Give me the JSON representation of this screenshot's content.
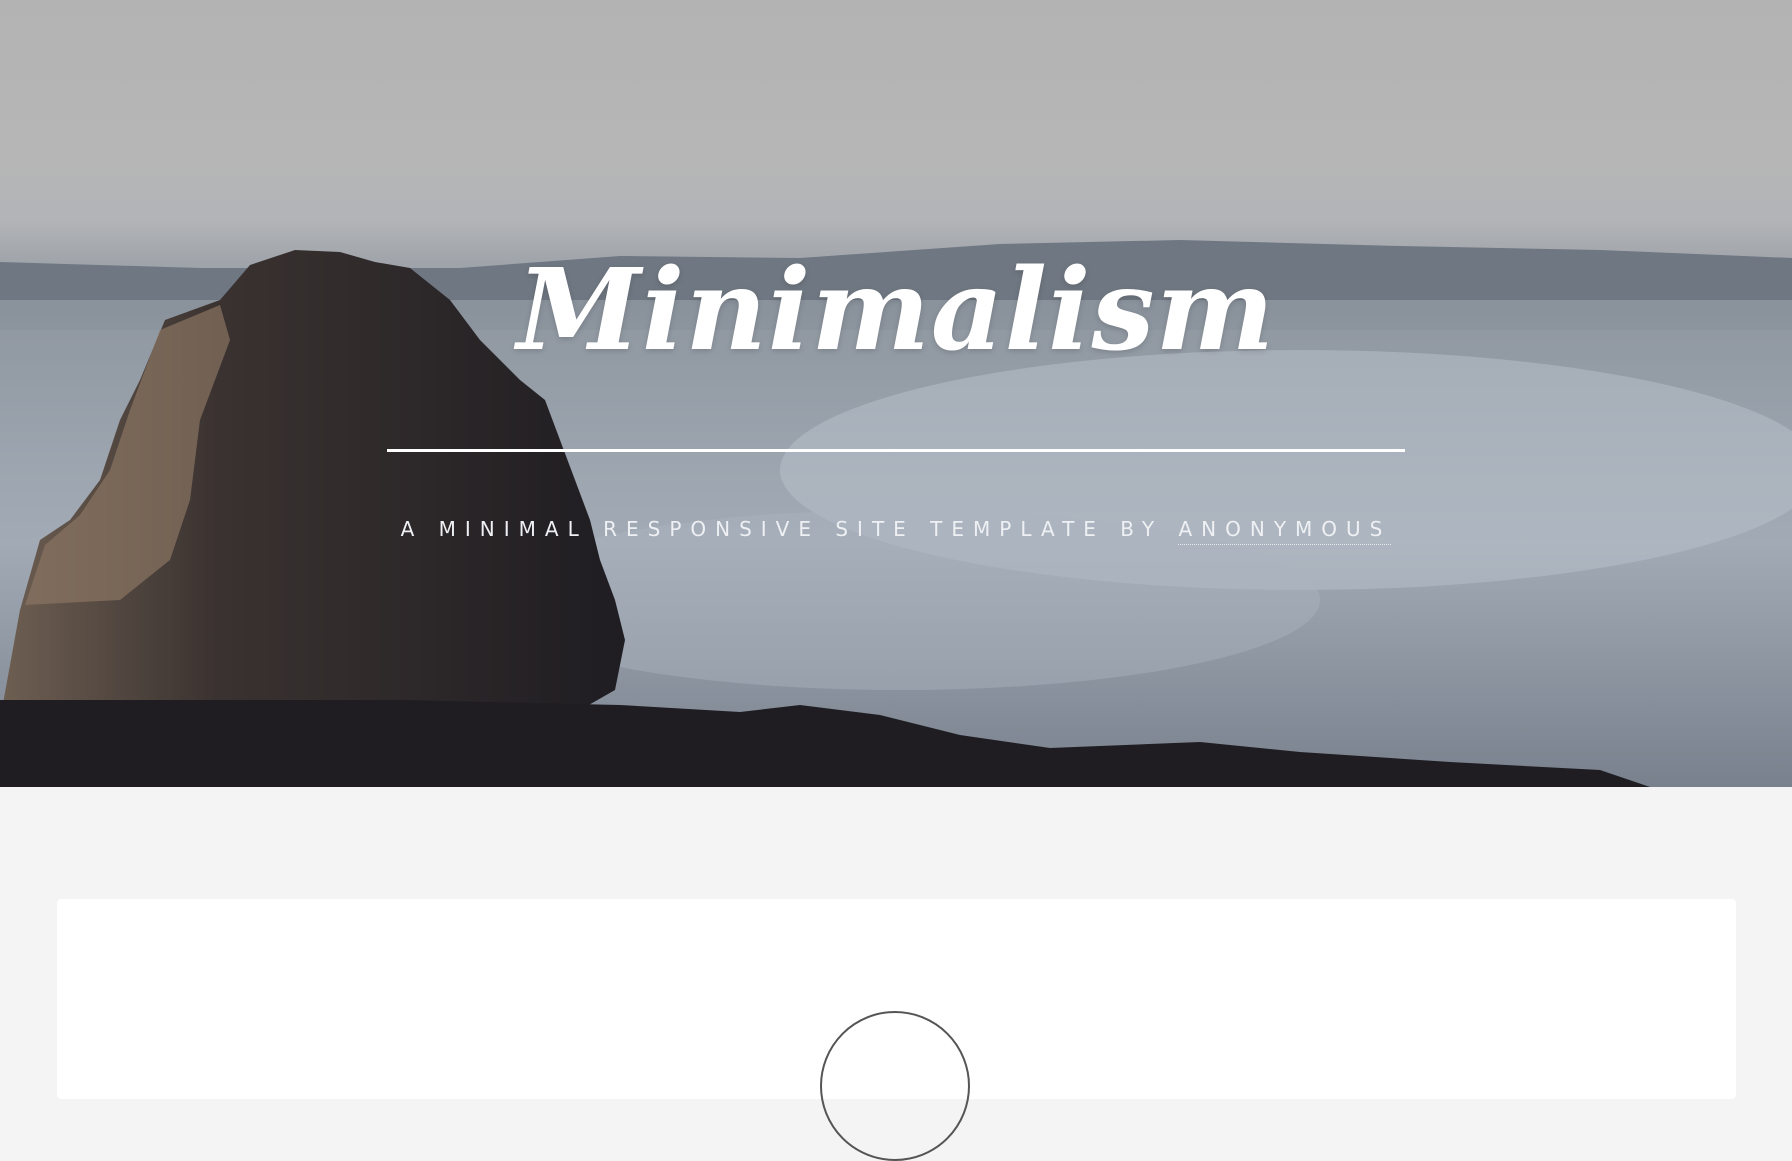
{
  "hero": {
    "title": "Minimalism",
    "subtitle_prefix": "A minimal responsive site template by ",
    "subtitle_link": "Anonymous"
  },
  "colors": {
    "page_background": "#f4f4f4",
    "card_background": "#ffffff",
    "hero_text": "#ffffff"
  }
}
